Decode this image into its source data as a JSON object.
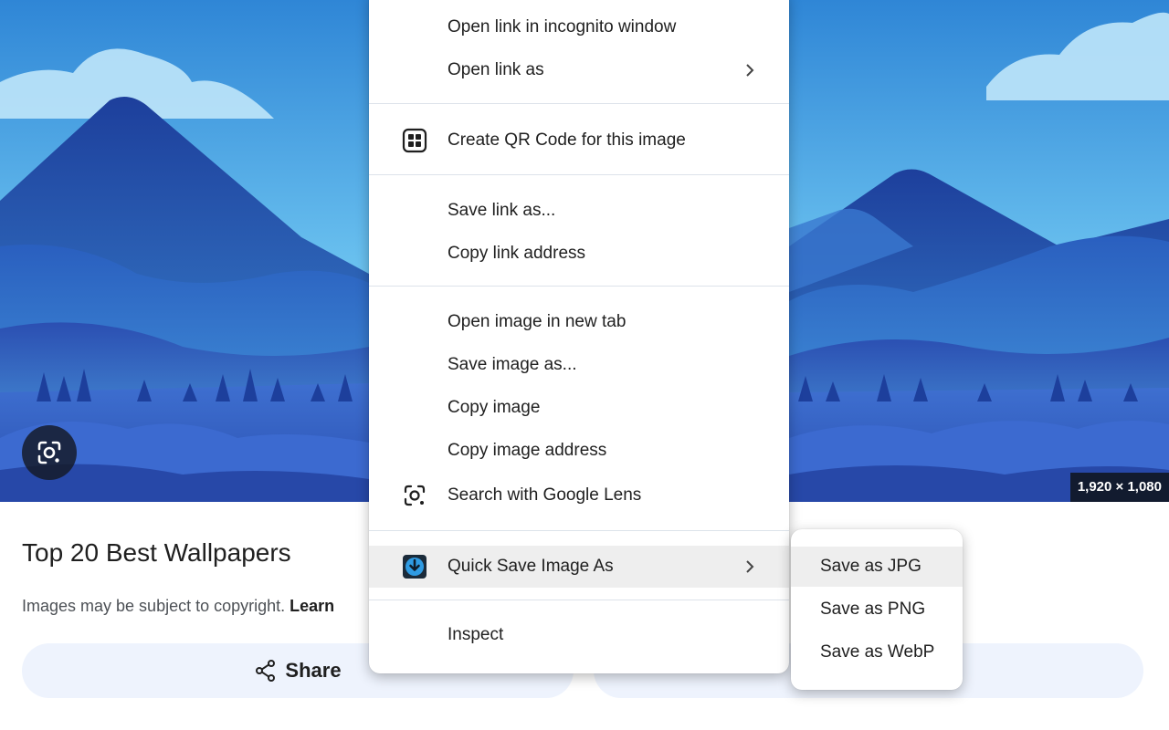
{
  "page": {
    "result_title": "Top 20 Best Wallpapers",
    "copyright_text": "Images may be subject to copyright.",
    "learn_more_label": "Learn",
    "image_dimensions": "1,920 × 1,080",
    "share_label": "Share"
  },
  "context_menu": {
    "items": [
      {
        "label": "Open link in incognito window"
      },
      {
        "label": "Open link as",
        "has_submenu": true
      },
      {
        "label": "Create QR Code for this image",
        "icon": "qr-code-icon"
      },
      {
        "label": "Save link as..."
      },
      {
        "label": "Copy link address"
      },
      {
        "label": "Open image in new tab"
      },
      {
        "label": "Save image as..."
      },
      {
        "label": "Copy image"
      },
      {
        "label": "Copy image address"
      },
      {
        "label": "Search with Google Lens",
        "icon": "google-lens-icon"
      },
      {
        "label": "Quick Save Image As",
        "icon": "download-icon",
        "has_submenu": true,
        "highlighted": true
      },
      {
        "label": "Inspect"
      }
    ]
  },
  "submenu": {
    "items": [
      {
        "label": "Save as JPG",
        "highlighted": true
      },
      {
        "label": "Save as PNG"
      },
      {
        "label": "Save as WebP"
      }
    ]
  },
  "colors": {
    "menu_highlight": "#eeeeee",
    "pill_background": "#eef3fd",
    "sky_top": "#2f86d6",
    "extension_icon": "#2f9be3"
  }
}
